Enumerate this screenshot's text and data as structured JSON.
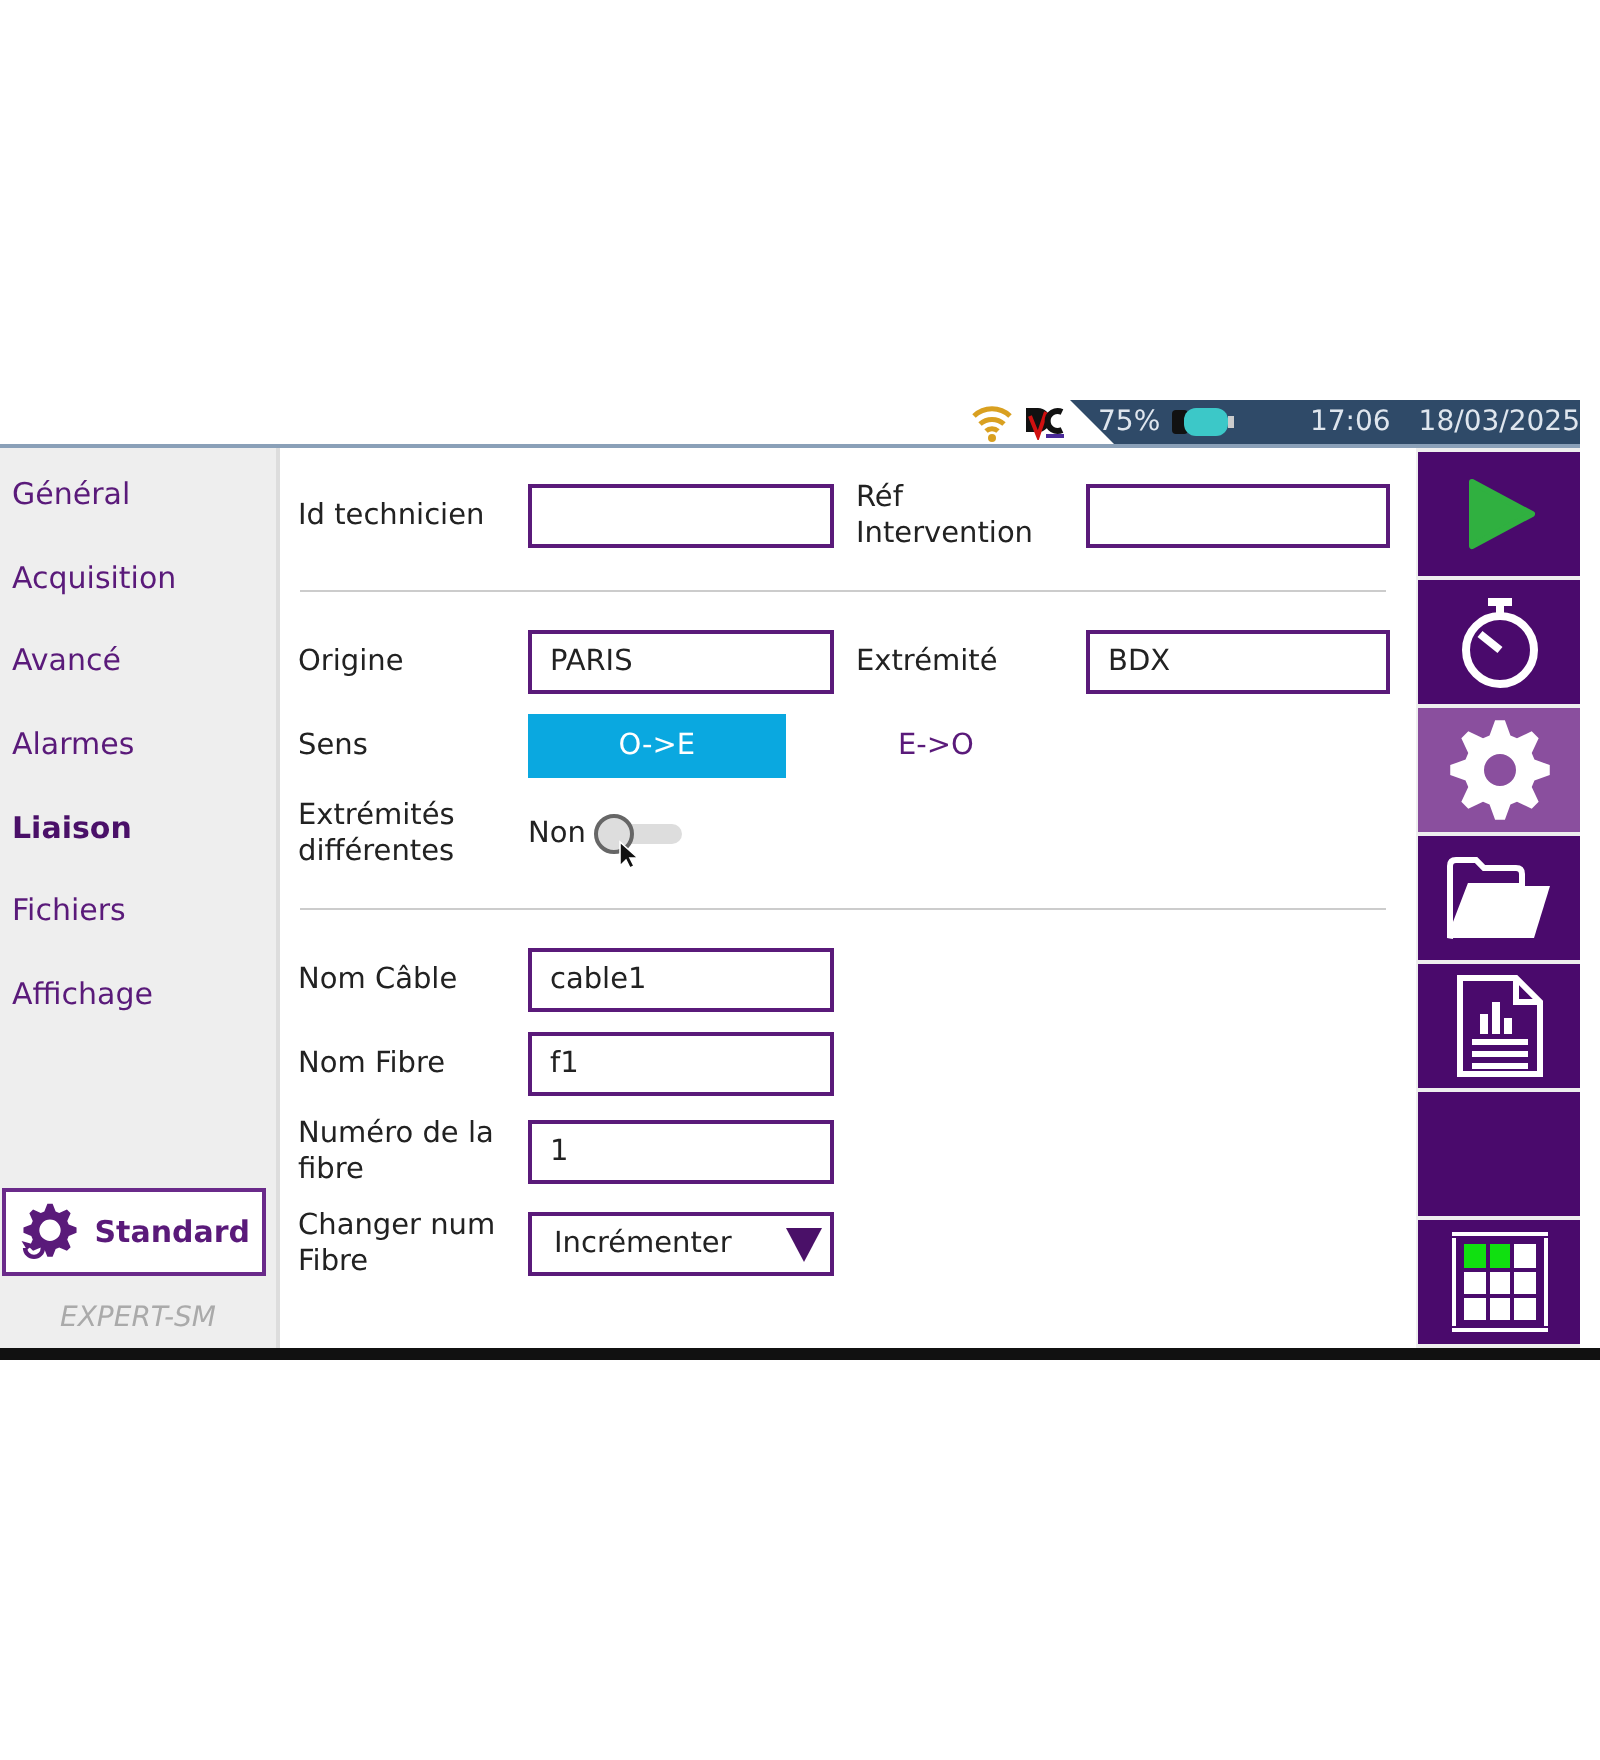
{
  "status_bar": {
    "battery": "75%",
    "time": "17:06",
    "date": "18/03/2025"
  },
  "sidebar": {
    "items": [
      {
        "label": "Général",
        "selected": false
      },
      {
        "label": "Acquisition",
        "selected": false
      },
      {
        "label": "Avancé",
        "selected": false
      },
      {
        "label": "Alarmes",
        "selected": false
      },
      {
        "label": "Liaison",
        "selected": true
      },
      {
        "label": "Fichiers",
        "selected": false
      },
      {
        "label": "Affichage",
        "selected": false
      }
    ],
    "profile_button": "Standard",
    "mode": "EXPERT-SM"
  },
  "form": {
    "sections": [
      {
        "rows": [
          {
            "kind": "pair",
            "fields": [
              {
                "label": "Id technicien"
              },
              {
                "label": "Réf Intervention"
              }
            ]
          }
        ]
      },
      {
        "rows": [
          {
            "kind": "pair",
            "fields": [
              {
                "label": "Origine",
                "value": "PARIS"
              },
              {
                "label": "Extrémité",
                "value": "BDX"
              }
            ]
          },
          {
            "kind": "segmented",
            "label": "Sens",
            "options": [
              {
                "label": "O->E",
                "selected": true
              },
              {
                "label": "E->O",
                "selected": false
              }
            ]
          },
          {
            "kind": "switch",
            "label": "Extrémités différentes",
            "text": "Non",
            "on": false
          }
        ]
      },
      {
        "rows": [
          {
            "kind": "text",
            "label": "Nom Câble",
            "value": "cable1"
          },
          {
            "kind": "text",
            "label": "Nom Fibre",
            "value": "f1"
          },
          {
            "kind": "text",
            "label": "Numéro de la fibre",
            "value": "1"
          },
          {
            "kind": "dropdown",
            "label": "Changer num Fibre",
            "value": "Incrémenter"
          }
        ]
      }
    ]
  },
  "toolbar": [
    {
      "kind": "play",
      "selected": false
    },
    {
      "kind": "timer",
      "selected": false
    },
    {
      "kind": "settings",
      "selected": true
    },
    {
      "kind": "folder",
      "selected": false
    },
    {
      "kind": "report",
      "selected": false
    },
    {
      "kind": "blank",
      "selected": false
    },
    {
      "kind": "grid",
      "selected": false
    }
  ]
}
